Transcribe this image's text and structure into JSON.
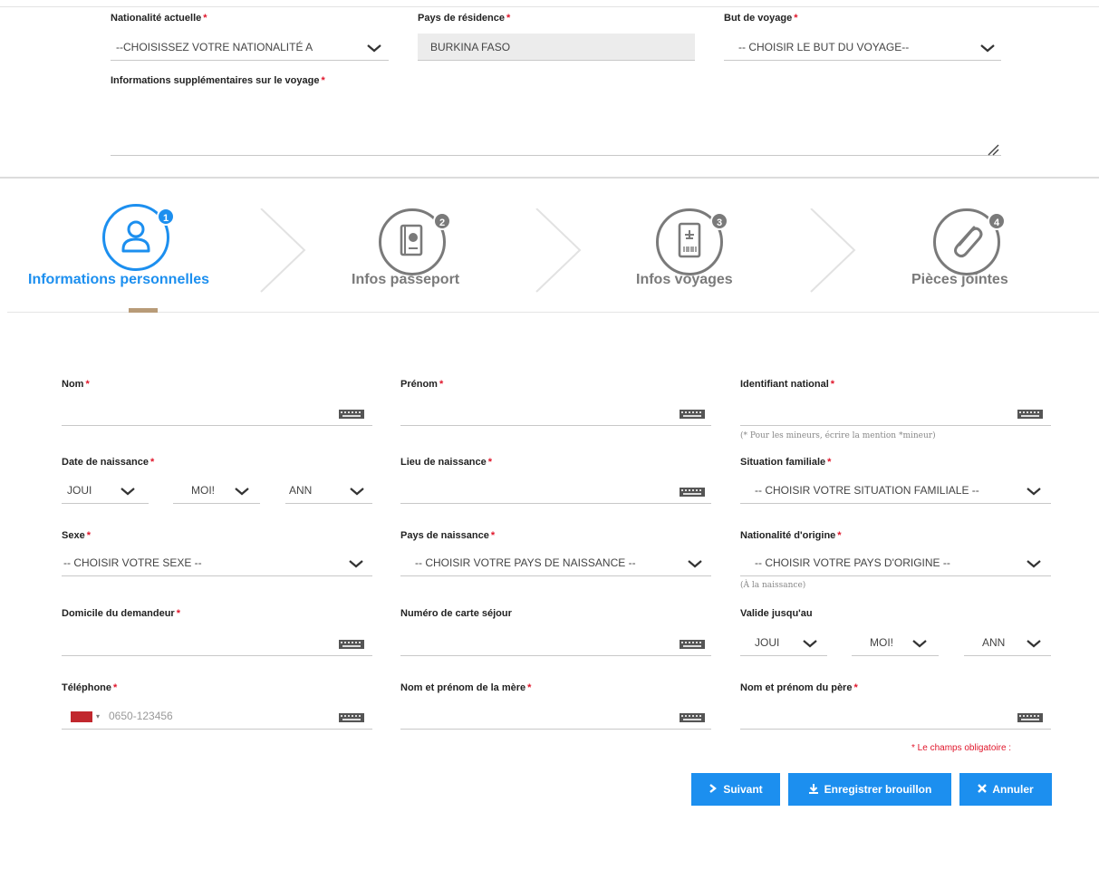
{
  "colors": {
    "accent": "#1c8fef",
    "required": "#e0162b",
    "active_bar": "#b89b78",
    "inactive": "#7a7a7a"
  },
  "top_form": {
    "nationality": {
      "label": "Nationalité actuelle",
      "value": "--CHOISISSEZ VOTRE NATIONALITÉ A"
    },
    "residence": {
      "label": "Pays de résidence",
      "value": "BURKINA FASO"
    },
    "purpose": {
      "label": "But de voyage",
      "value": "-- CHOISIR LE BUT DU VOYAGE--"
    },
    "extra_info": {
      "label": "Informations supplémentaires sur le voyage",
      "value": ""
    }
  },
  "wizard": {
    "steps": [
      {
        "number": "1",
        "label": "Informations personnelles",
        "icon": "user-icon",
        "active": true
      },
      {
        "number": "2",
        "label": "Infos passeport",
        "icon": "passport-icon",
        "active": false
      },
      {
        "number": "3",
        "label": "Infos voyages",
        "icon": "boarding-pass-icon",
        "active": false
      },
      {
        "number": "4",
        "label": "Pièces jointes",
        "icon": "paperclip-icon",
        "active": false
      }
    ]
  },
  "form": {
    "required_mark": "*",
    "nom": {
      "label": "Nom",
      "value": ""
    },
    "prenom": {
      "label": "Prénom",
      "value": ""
    },
    "national_id": {
      "label": "Identifiant national",
      "value": "",
      "hint": "(* Pour les mineurs, écrire la mention *mineur)"
    },
    "birth_date": {
      "label": "Date de naissance",
      "day": "JOUI",
      "month": "MOI!",
      "year": "ANN"
    },
    "birth_place": {
      "label": "Lieu de naissance",
      "value": ""
    },
    "marital": {
      "label": "Situation familiale",
      "value": "-- CHOISIR VOTRE SITUATION FAMILIALE --"
    },
    "sex": {
      "label": "Sexe",
      "value": "-- CHOISIR VOTRE SEXE --"
    },
    "birth_country": {
      "label": "Pays de naissance",
      "value": "-- CHOISIR VOTRE PAYS DE NAISSANCE --"
    },
    "origin": {
      "label": "Nationalité d'origine",
      "value": "-- CHOISIR VOTRE PAYS D'ORIGINE --",
      "hint": "(À la naissance)"
    },
    "address": {
      "label": "Domicile du demandeur",
      "value": ""
    },
    "residence_card": {
      "label": "Numéro de carte séjour",
      "value": ""
    },
    "valid_until": {
      "label": "Valide jusqu'au",
      "day": "JOUI",
      "month": "MOI!",
      "year": "ANN"
    },
    "phone": {
      "label": "Téléphone",
      "placeholder": "0650-123456",
      "caret": "▾"
    },
    "mother": {
      "label": "Nom et prénom de la mère",
      "value": ""
    },
    "father": {
      "label": "Nom et prénom du père",
      "value": ""
    }
  },
  "required_note": "* Le champs obligatoire :",
  "buttons": {
    "next": {
      "label": "Suivant",
      "icon": "chevron-right-icon"
    },
    "save": {
      "label": "Enregistrer brouillon",
      "icon": "download-icon"
    },
    "cancel": {
      "label": "Annuler",
      "icon": "close-icon"
    }
  }
}
